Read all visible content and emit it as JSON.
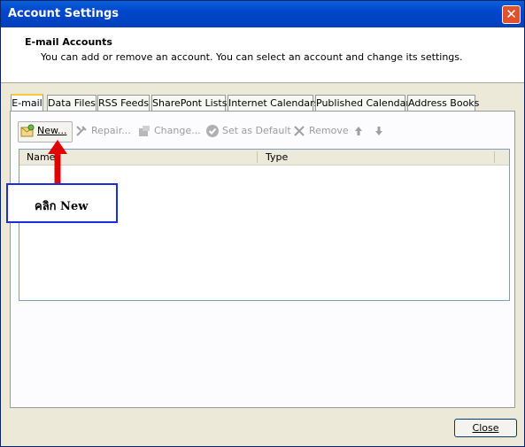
{
  "window": {
    "title": "Account Settings",
    "close_glyph": "✕"
  },
  "header": {
    "title": "E-mail Accounts",
    "subtitle": "You can add or remove an account. You can select an account and change its settings."
  },
  "tabs": [
    {
      "label": "E-mail",
      "active": true
    },
    {
      "label": "Data Files"
    },
    {
      "label": "RSS Feeds"
    },
    {
      "label": "SharePont Lists"
    },
    {
      "label": "Internet Calendars"
    },
    {
      "label": "Published Calendars"
    },
    {
      "label": "Address Books"
    }
  ],
  "toolbar": {
    "new_label": "New...",
    "repair_label": "Repair...",
    "change_label": "Change...",
    "set_default_label": "Set as Default",
    "remove_label": "Remove"
  },
  "list": {
    "columns": [
      "Name",
      "Type"
    ]
  },
  "footer": {
    "close_label": "Close"
  },
  "annotation": {
    "text": "คลิก New",
    "arrow_color": "#e00000",
    "box_color": "#1a2ee0"
  }
}
